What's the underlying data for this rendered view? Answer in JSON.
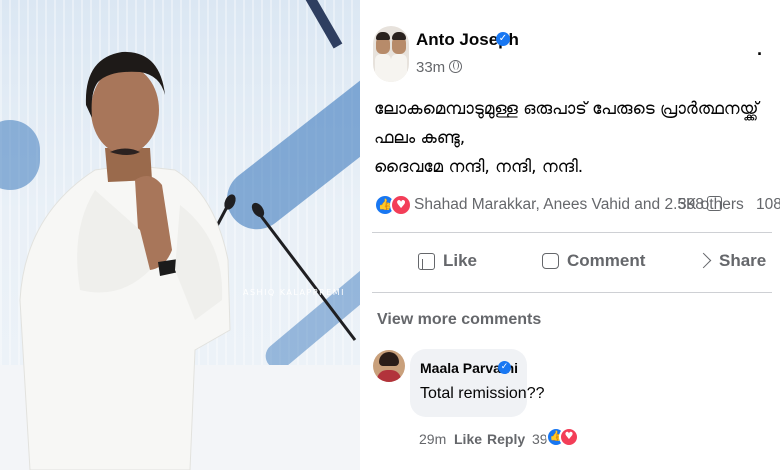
{
  "photo": {
    "watermark": "ASHIQ KALAPPREMI"
  },
  "post": {
    "author": "Anto Joseph",
    "time": "33m",
    "lines": [
      "ലോകമെമ്പാടുമുള്ള ഒരുപാട് പേരുടെ പ്രാർത്ഥനയ്ക്ക്",
      "ഫലം കണ്ടു,",
      "ദൈവമേ നന്ദി, നന്ദി, നന്ദി."
    ],
    "reactions": {
      "names": "Shahad Marakkar, Anees Vahid and 2.5K others",
      "comments": "398",
      "shares": "108"
    },
    "actions": {
      "like": "Like",
      "comment": "Comment",
      "share": "Share"
    }
  },
  "comments": {
    "view_more": "View more comments",
    "items": [
      {
        "name": "Maala Parvathi",
        "text": "Total remission??",
        "time": "29m",
        "like": "Like",
        "reply": "Reply",
        "reaction_count": "39"
      }
    ]
  },
  "icons": {
    "verified": "verified-badge-icon",
    "globe": "globe-icon",
    "more": "more-options-icon",
    "like": "thumbs-up-icon",
    "love": "heart-icon",
    "comment": "comment-bubble-icon",
    "share": "share-arrow-icon"
  },
  "colors": {
    "facebook_blue": "#1877f2",
    "love_red": "#f33e58",
    "secondary_text": "#65676b",
    "comment_bg": "#f0f2f5"
  }
}
